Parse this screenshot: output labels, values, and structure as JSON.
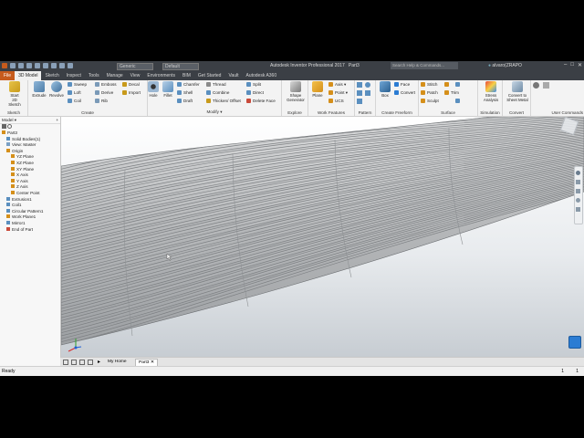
{
  "titlebar": {
    "app_title": "Autodesk Inventor Professional 2017",
    "document": "Part3",
    "material": "Generic",
    "appearance": "Default",
    "search_placeholder": "Search Help & Commands...",
    "user": "alvaro(ZRAPO",
    "min": "–",
    "max": "□",
    "close": "✕"
  },
  "tabs": [
    "File",
    "3D Model",
    "Sketch",
    "Inspect",
    "Tools",
    "Manage",
    "View",
    "Environments",
    "BIM",
    "Get Started",
    "Vault",
    "Autodesk A360"
  ],
  "ribbon": {
    "sketch": {
      "start_line1": "Start",
      "start_line2": "2D Sketch",
      "title": "Sketch"
    },
    "create": {
      "extrude": "Extrude",
      "revolve": "Revolve",
      "sweep": "Sweep",
      "loft": "Loft",
      "coil": "Coil",
      "emboss": "Emboss",
      "derive": "Derive",
      "rib": "Rib",
      "decal": "Decal",
      "import": "Import",
      "title": "Create"
    },
    "modify": {
      "hole": "Hole",
      "fillet": "Fillet",
      "chamfer": "Chamfer",
      "shell": "Shell",
      "draft": "Draft",
      "thread": "Thread",
      "combine": "Combine",
      "thicken": "Thicken/ Offset",
      "split": "Split",
      "direct": "Direct",
      "delete_face": "Delete Face",
      "title": "Modify ▾"
    },
    "explore": {
      "shape_line1": "Shape",
      "shape_line2": "Generator",
      "title": "Explore"
    },
    "work": {
      "plane": "Plane",
      "axis": "Axis ▾",
      "point": "Point ▾",
      "ucs": "UCS",
      "title": "Work Features"
    },
    "pattern": {
      "title": "Pattern"
    },
    "freeform": {
      "box": "Box",
      "face": "Face",
      "convert": "Convert",
      "title": "Create Freeform"
    },
    "surface": {
      "stitch": "Stitch",
      "patch": "Patch",
      "sculpt": "Sculpt",
      "trim": "Trim",
      "title": "Surface"
    },
    "simulation": {
      "stress_line1": "Stress",
      "stress_line2": "Analysis",
      "title": "Simulation"
    },
    "convert": {
      "sheet_line1": "Convert to",
      "sheet_line2": "Sheet Metal",
      "title": "Convert"
    },
    "user": {
      "title": "User Commands"
    }
  },
  "browser": {
    "header": "Model ▾",
    "items": [
      {
        "label": "Part3",
        "indent": 0
      },
      {
        "label": "Solid Bodies(1)",
        "indent": 1
      },
      {
        "label": "View: Master",
        "indent": 1
      },
      {
        "label": "Origin",
        "indent": 1
      },
      {
        "label": "YZ Plane",
        "indent": 2
      },
      {
        "label": "XZ Plane",
        "indent": 2
      },
      {
        "label": "XY Plane",
        "indent": 2
      },
      {
        "label": "X Axis",
        "indent": 2
      },
      {
        "label": "Y Axis",
        "indent": 2
      },
      {
        "label": "Z Axis",
        "indent": 2
      },
      {
        "label": "Center Point",
        "indent": 2
      },
      {
        "label": "Extrusion1",
        "indent": 1
      },
      {
        "label": "Coil1",
        "indent": 1
      },
      {
        "label": "Circular Pattern1",
        "indent": 1
      },
      {
        "label": "Work Plane1",
        "indent": 1
      },
      {
        "label": "Mirror1",
        "indent": 1
      },
      {
        "label": "End of Part",
        "indent": 1
      }
    ]
  },
  "bottom": {
    "home": "My Home",
    "doc": "Part3",
    "close": "✕"
  },
  "status": {
    "text": "Ready",
    "num1": "1",
    "num2": "1"
  },
  "colors": {
    "file_tab": "#c65b1d",
    "title_bg": "#3b3f45",
    "accent_blue": "#2b7cd3"
  }
}
